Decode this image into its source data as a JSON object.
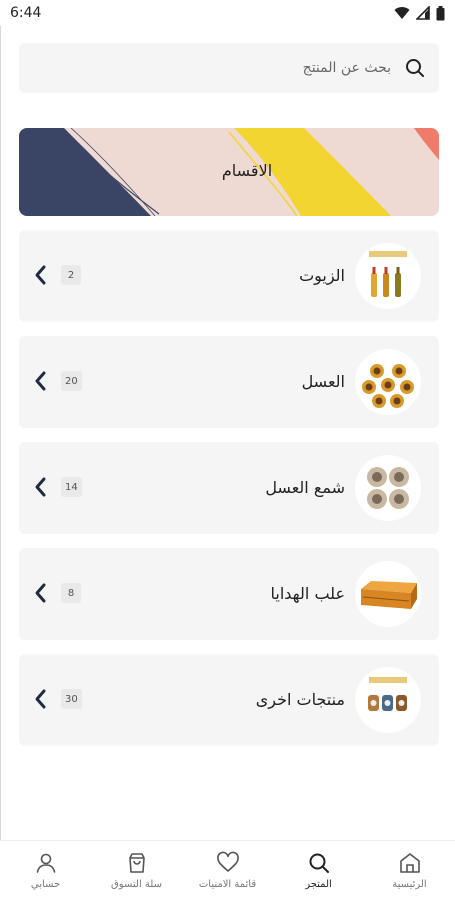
{
  "status_bar": {
    "time": "6:44"
  },
  "search": {
    "placeholder": "بحث عن المنتج"
  },
  "banner": {
    "title": "الاقسام"
  },
  "categories": [
    {
      "name": "الزيوت",
      "count": "2",
      "thumb": "oil-bottles"
    },
    {
      "name": "العسل",
      "count": "20",
      "thumb": "honey-jars"
    },
    {
      "name": "شمع العسل",
      "count": "14",
      "thumb": "beeswax-jars"
    },
    {
      "name": "علب الهدايا",
      "count": "8",
      "thumb": "gift-box"
    },
    {
      "name": "منتجات اخرى",
      "count": "30",
      "thumb": "other-products"
    }
  ],
  "bottom_nav": {
    "home": "الرئيسية",
    "store": "المتجر",
    "wishlist": "قائمة الامنيات",
    "cart": "سلة التسوق",
    "account": "حسابي",
    "active": "store"
  },
  "colors": {
    "banner_bg": "#efd9d3",
    "banner_navy": "#3a4565",
    "banner_yellow": "#f3d531",
    "banner_coral": "#ef7c6a",
    "card_bg": "#f5f5f5"
  }
}
